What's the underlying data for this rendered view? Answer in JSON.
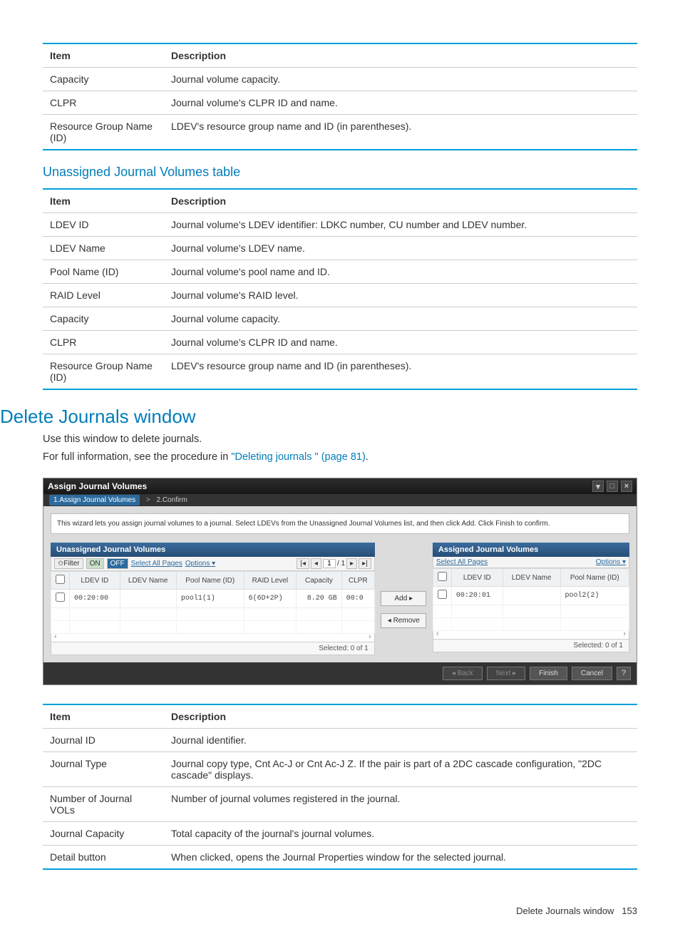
{
  "tables": {
    "top": {
      "head_item": "Item",
      "head_desc": "Description",
      "rows": [
        {
          "item": "Capacity",
          "desc": "Journal volume capacity."
        },
        {
          "item": "CLPR",
          "desc": "Journal volume's CLPR ID and name."
        },
        {
          "item": "Resource Group Name (ID)",
          "desc": "LDEV's resource group name and ID (in parentheses)."
        }
      ]
    },
    "unassigned": {
      "title": "Unassigned Journal Volumes table",
      "head_item": "Item",
      "head_desc": "Description",
      "rows": [
        {
          "item": "LDEV ID",
          "desc": "Journal volume's LDEV identifier: LDKC number, CU number and LDEV number."
        },
        {
          "item": "LDEV Name",
          "desc": "Journal volume's LDEV name."
        },
        {
          "item": "Pool Name (ID)",
          "desc": "Journal volume's pool name and ID."
        },
        {
          "item": "RAID Level",
          "desc": "Journal volume's RAID level."
        },
        {
          "item": "Capacity",
          "desc": "Journal volume capacity."
        },
        {
          "item": "CLPR",
          "desc": "Journal volume's CLPR ID and name."
        },
        {
          "item": "Resource Group Name (ID)",
          "desc": "LDEV's resource group name and ID (in parentheses)."
        }
      ]
    },
    "delete": {
      "head_item": "Item",
      "head_desc": "Description",
      "rows": [
        {
          "item": "Journal ID",
          "desc": "Journal identifier."
        },
        {
          "item": "Journal Type",
          "desc": "Journal copy type, Cnt Ac-J or Cnt Ac-J Z. If the pair is part of a 2DC cascade configuration, \"2DC cascade\" displays."
        },
        {
          "item": "Number of Journal VOLs",
          "desc": "Number of journal volumes registered in the journal."
        },
        {
          "item": "Journal Capacity",
          "desc": "Total capacity of the journal's journal volumes."
        },
        {
          "item": "Detail button",
          "desc": "When clicked, opens the Journal Properties window for the selected journal."
        }
      ]
    }
  },
  "section": {
    "title": "Delete Journals window",
    "p1": "Use this window to delete journals.",
    "p2a": "For full information, see the procedure in ",
    "p2link": "\"Deleting journals \" (page 81)",
    "p2b": "."
  },
  "wizard": {
    "title": "Assign Journal Volumes",
    "crumb1": "1.Assign Journal Volumes",
    "crumb_sep": ">",
    "crumb2": "2.Confirm",
    "desc": "This wizard lets you assign journal volumes to a journal. Select LDEVs from the Unassigned Journal Volumes list, and then click Add. Click Finish to confirm.",
    "left_title": "Unassigned Journal Volumes",
    "right_title": "Assigned Journal Volumes",
    "toolbar": {
      "filter": "✩Filter",
      "on": "ON",
      "off": "OFF",
      "select_all": "Select All Pages",
      "options": "Options ▾",
      "page_cur": "1",
      "page_sep": "/ 1"
    },
    "grid_left": {
      "cols": [
        "",
        "LDEV ID",
        "LDEV Name",
        "Pool Name (ID)",
        "RAID Level",
        "Capacity",
        "CLPR"
      ],
      "row": [
        "",
        "00:20:00",
        "",
        "pool1(1)",
        "6(6D+2P)",
        "8.20 GB",
        "00:0"
      ],
      "selected": "Selected:  0    of  1"
    },
    "grid_right": {
      "cols": [
        "",
        "LDEV ID",
        "LDEV Name",
        "Pool Name (ID)"
      ],
      "row": [
        "",
        "00:20:01",
        "",
        "pool2(2)"
      ],
      "selected": "Selected:  0    of  1"
    },
    "btn_add": "Add ▸",
    "btn_remove": "◂ Remove",
    "footer": {
      "back": "◂ Back",
      "next": "Next ▸",
      "finish": "Finish",
      "cancel": "Cancel",
      "help": "?"
    }
  },
  "page_footer": {
    "label": "Delete Journals window",
    "num": "153"
  }
}
